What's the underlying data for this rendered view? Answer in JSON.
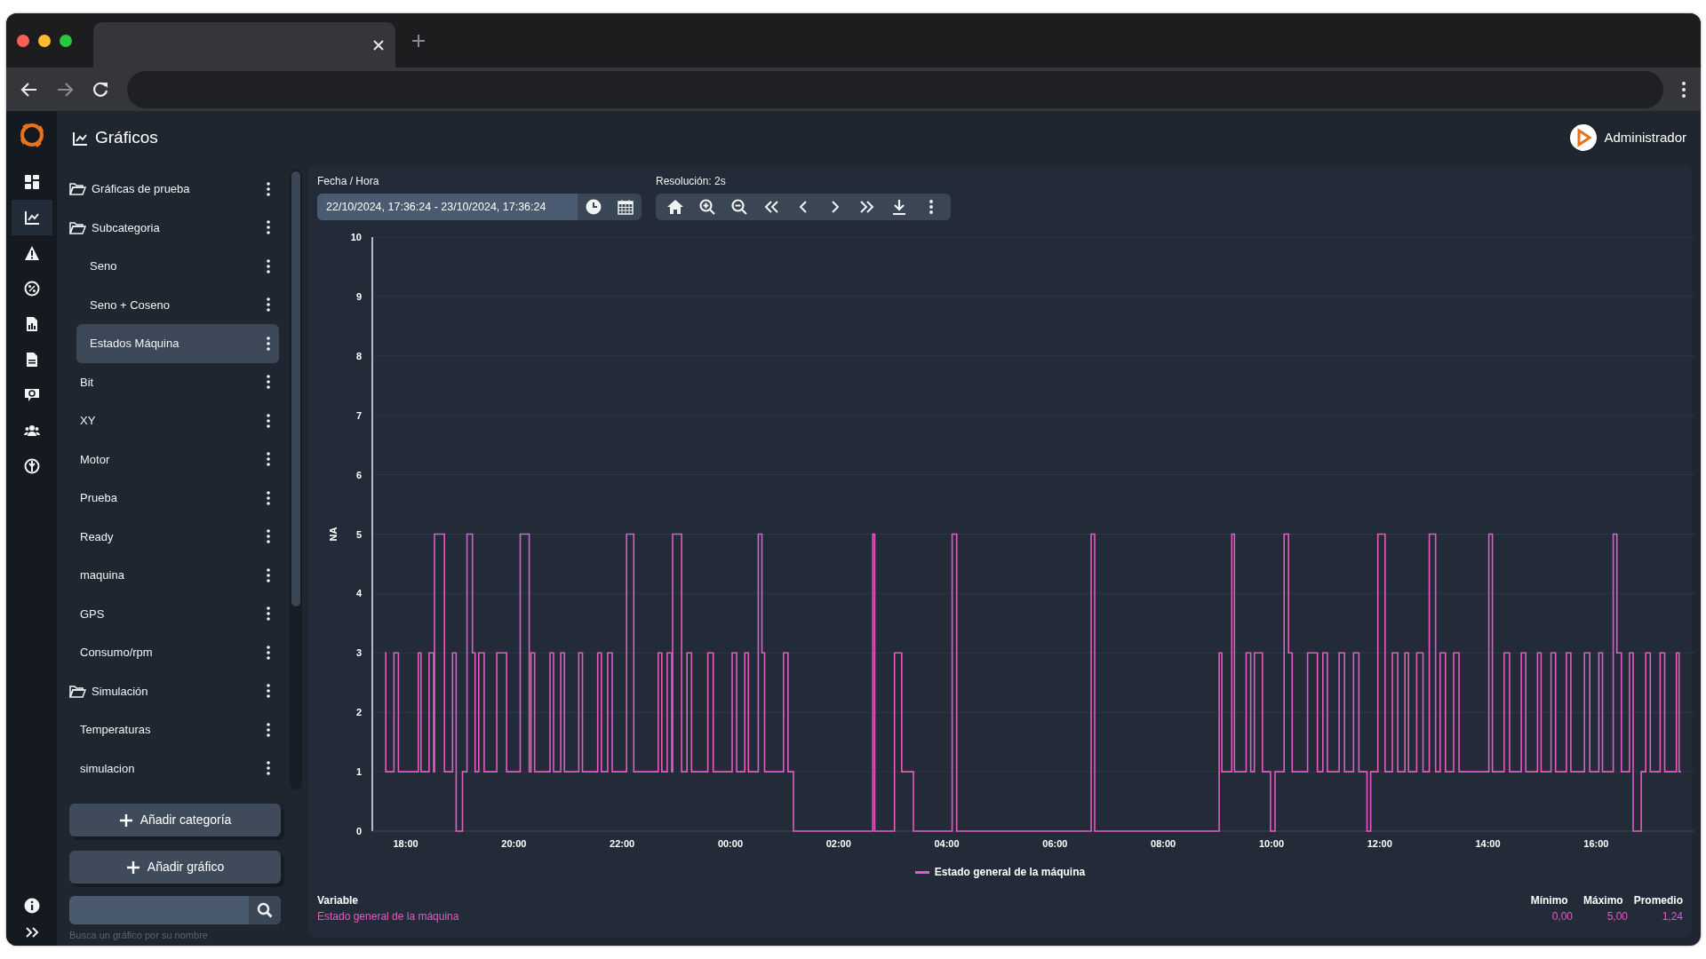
{
  "header": {
    "title": "Gráficos",
    "user": "Administrador"
  },
  "nav_rail": [
    {
      "kind": "dashboard",
      "selected": false
    },
    {
      "kind": "charts",
      "selected": true
    },
    {
      "kind": "alerts",
      "selected": false
    },
    {
      "kind": "percent",
      "selected": false
    },
    {
      "kind": "report",
      "selected": false
    },
    {
      "kind": "document",
      "selected": false
    },
    {
      "kind": "chat",
      "selected": false
    },
    {
      "kind": "users",
      "selected": false
    },
    {
      "kind": "globe",
      "selected": false
    }
  ],
  "tree": {
    "items": [
      {
        "label": "Gráficas de prueba",
        "expanded": true,
        "children": [
          {
            "label": "Subcategoria",
            "expanded": true,
            "children": [
              {
                "label": "Seno",
                "selected": false
              },
              {
                "label": "Seno + Coseno",
                "selected": false
              },
              {
                "label": "Estados Máquina",
                "selected": true
              }
            ]
          },
          {
            "label": "Bit",
            "selected": false
          },
          {
            "label": "XY",
            "selected": false
          },
          {
            "label": "Motor",
            "selected": false
          },
          {
            "label": "Prueba",
            "selected": false
          },
          {
            "label": "Ready",
            "selected": false
          },
          {
            "label": "maquina",
            "selected": false
          },
          {
            "label": "GPS",
            "selected": false
          },
          {
            "label": "Consumo/rpm",
            "selected": false
          }
        ]
      },
      {
        "label": "Simulación",
        "expanded": true,
        "children": [
          {
            "label": "Temperaturas",
            "selected": false
          },
          {
            "label": "simulacion",
            "selected": false
          }
        ]
      }
    ]
  },
  "buttons": [
    "Añadir categoría",
    "Añadir gráfico"
  ],
  "search": {
    "hint": "Busca un gráfico por su nombre"
  },
  "controls": {
    "date_label": "Fecha / Hora",
    "date_value": "22/10/2024, 17:36:24 - 23/10/2024, 17:36:24",
    "resolution": "Resolución: 2s"
  },
  "chart": {
    "chart_data": {
      "type": "line",
      "ylabel": "NA",
      "grid": true,
      "x": [
        "2024-10-22T17:37",
        "2024-10-22T17:38",
        "2024-10-22T17:38",
        "2024-10-22T17:47",
        "2024-10-22T17:47",
        "2024-10-22T17:52",
        "2024-10-22T17:52",
        "2024-10-22T18:14",
        "2024-10-22T18:14",
        "2024-10-22T18:17",
        "2024-10-22T18:17",
        "2024-10-22T18:26",
        "2024-10-22T18:26",
        "2024-10-22T18:31",
        "2024-10-22T18:31",
        "2024-10-22T18:32",
        "2024-10-22T18:32",
        "2024-10-22T18:43",
        "2024-10-22T18:43",
        "2024-10-22T18:52",
        "2024-10-22T18:52",
        "2024-10-22T18:56",
        "2024-10-22T18:56",
        "2024-10-22T19:03",
        "2024-10-22T19:03",
        "2024-10-22T19:08",
        "2024-10-22T19:08",
        "2024-10-22T19:14",
        "2024-10-22T19:14",
        "2024-10-22T19:17",
        "2024-10-22T19:17",
        "2024-10-22T19:21",
        "2024-10-22T19:21",
        "2024-10-22T19:27",
        "2024-10-22T19:27",
        "2024-10-22T19:41",
        "2024-10-22T19:41",
        "2024-10-22T19:52",
        "2024-10-22T19:52",
        "2024-10-22T20:07",
        "2024-10-22T20:07",
        "2024-10-22T20:17",
        "2024-10-22T20:17",
        "2024-10-22T20:19",
        "2024-10-22T20:19",
        "2024-10-22T20:23",
        "2024-10-22T20:23",
        "2024-10-22T20:40",
        "2024-10-22T20:40",
        "2024-10-22T20:44",
        "2024-10-22T20:44",
        "2024-10-22T20:52",
        "2024-10-22T20:52",
        "2024-10-22T20:56",
        "2024-10-22T20:56",
        "2024-10-22T21:12",
        "2024-10-22T21:12",
        "2024-10-22T21:16",
        "2024-10-22T21:16",
        "2024-10-22T21:33",
        "2024-10-22T21:33",
        "2024-10-22T21:37",
        "2024-10-22T21:37",
        "2024-10-22T21:44",
        "2024-10-22T21:44",
        "2024-10-22T21:49",
        "2024-10-22T21:49",
        "2024-10-22T22:05",
        "2024-10-22T22:05",
        "2024-10-22T22:13",
        "2024-10-22T22:13",
        "2024-10-22T22:40",
        "2024-10-22T22:40",
        "2024-10-22T22:44",
        "2024-10-22T22:44",
        "2024-10-22T22:50",
        "2024-10-22T22:50",
        "2024-10-22T22:55",
        "2024-10-22T22:55",
        "2024-10-22T22:56",
        "2024-10-22T22:56",
        "2024-10-22T23:06",
        "2024-10-22T23:06",
        "2024-10-22T23:12",
        "2024-10-22T23:12",
        "2024-10-22T23:17",
        "2024-10-22T23:17",
        "2024-10-22T23:35",
        "2024-10-22T23:35",
        "2024-10-22T23:41",
        "2024-10-22T23:41",
        "2024-10-23T00:02",
        "2024-10-23T00:02",
        "2024-10-23T00:07",
        "2024-10-23T00:07",
        "2024-10-23T00:16",
        "2024-10-23T00:16",
        "2024-10-23T00:20",
        "2024-10-23T00:20",
        "2024-10-23T00:31",
        "2024-10-23T00:31",
        "2024-10-23T00:35",
        "2024-10-23T00:35",
        "2024-10-23T00:38",
        "2024-10-23T00:38",
        "2024-10-23T00:59",
        "2024-10-23T00:59",
        "2024-10-23T01:04",
        "2024-10-23T01:04",
        "2024-10-23T01:10",
        "2024-10-23T01:10",
        "2024-10-23T02:38",
        "2024-10-23T02:38",
        "2024-10-23T02:40",
        "2024-10-23T02:40",
        "2024-10-23T03:02",
        "2024-10-23T03:02",
        "2024-10-23T03:10",
        "2024-10-23T03:10",
        "2024-10-23T03:23",
        "2024-10-23T03:23",
        "2024-10-23T04:06",
        "2024-10-23T04:06",
        "2024-10-23T04:11",
        "2024-10-23T04:11",
        "2024-10-23T06:40",
        "2024-10-23T06:40",
        "2024-10-23T06:44",
        "2024-10-23T06:44",
        "2024-10-23T09:02",
        "2024-10-23T09:02",
        "2024-10-23T09:05",
        "2024-10-23T09:05",
        "2024-10-23T09:16",
        "2024-10-23T09:16",
        "2024-10-23T09:19",
        "2024-10-23T09:19",
        "2024-10-23T09:32",
        "2024-10-23T09:32",
        "2024-10-23T09:37",
        "2024-10-23T09:37",
        "2024-10-23T09:41",
        "2024-10-23T09:41",
        "2024-10-23T09:50",
        "2024-10-23T09:50",
        "2024-10-23T09:59",
        "2024-10-23T09:59",
        "2024-10-23T10:04",
        "2024-10-23T10:04",
        "2024-10-23T10:14",
        "2024-10-23T10:14",
        "2024-10-23T10:19",
        "2024-10-23T10:19",
        "2024-10-23T10:23",
        "2024-10-23T10:23",
        "2024-10-23T10:40",
        "2024-10-23T10:40",
        "2024-10-23T10:51",
        "2024-10-23T10:51",
        "2024-10-23T10:57",
        "2024-10-23T10:57",
        "2024-10-23T11:02",
        "2024-10-23T11:02",
        "2024-10-23T11:15",
        "2024-10-23T11:15",
        "2024-10-23T11:21",
        "2024-10-23T11:21",
        "2024-10-23T11:31",
        "2024-10-23T11:31",
        "2024-10-23T11:37",
        "2024-10-23T11:37",
        "2024-10-23T11:46",
        "2024-10-23T11:46",
        "2024-10-23T11:50",
        "2024-10-23T11:50",
        "2024-10-23T11:58",
        "2024-10-23T11:58",
        "2024-10-23T12:06",
        "2024-10-23T12:06",
        "2024-10-23T12:14",
        "2024-10-23T12:14",
        "2024-10-23T12:20",
        "2024-10-23T12:20",
        "2024-10-23T12:28",
        "2024-10-23T12:28",
        "2024-10-23T12:32",
        "2024-10-23T12:32",
        "2024-10-23T12:41",
        "2024-10-23T12:41",
        "2024-10-23T12:48",
        "2024-10-23T12:48",
        "2024-10-23T12:55",
        "2024-10-23T12:55",
        "2024-10-23T13:02",
        "2024-10-23T13:02",
        "2024-10-23T13:07",
        "2024-10-23T13:07",
        "2024-10-23T13:13",
        "2024-10-23T13:13",
        "2024-10-23T13:22",
        "2024-10-23T13:22",
        "2024-10-23T13:28",
        "2024-10-23T13:28",
        "2024-10-23T14:01",
        "2024-10-23T14:01",
        "2024-10-23T14:05",
        "2024-10-23T14:05",
        "2024-10-23T14:18",
        "2024-10-23T14:18",
        "2024-10-23T14:24",
        "2024-10-23T14:24",
        "2024-10-23T14:37",
        "2024-10-23T14:37",
        "2024-10-23T14:42",
        "2024-10-23T14:42",
        "2024-10-23T14:55",
        "2024-10-23T14:55",
        "2024-10-23T14:59",
        "2024-10-23T14:59",
        "2024-10-23T15:10",
        "2024-10-23T15:10",
        "2024-10-23T15:15",
        "2024-10-23T15:15",
        "2024-10-23T15:27",
        "2024-10-23T15:27",
        "2024-10-23T15:32",
        "2024-10-23T15:32",
        "2024-10-23T15:47",
        "2024-10-23T15:47",
        "2024-10-23T15:53",
        "2024-10-23T15:53",
        "2024-10-23T16:03",
        "2024-10-23T16:03",
        "2024-10-23T16:07",
        "2024-10-23T16:07",
        "2024-10-23T16:19",
        "2024-10-23T16:19",
        "2024-10-23T16:23",
        "2024-10-23T16:23",
        "2024-10-23T16:28",
        "2024-10-23T16:28",
        "2024-10-23T16:37",
        "2024-10-23T16:37",
        "2024-10-23T16:41",
        "2024-10-23T16:41",
        "2024-10-23T16:50",
        "2024-10-23T16:50",
        "2024-10-23T16:55",
        "2024-10-23T16:55",
        "2024-10-23T17:00",
        "2024-10-23T17:00",
        "2024-10-23T17:11",
        "2024-10-23T17:11",
        "2024-10-23T17:16",
        "2024-10-23T17:16",
        "2024-10-23T17:29",
        "2024-10-23T17:29",
        "2024-10-23T17:32",
        "2024-10-23T17:32",
        "2024-10-23T17:34"
      ],
      "series": [
        {
          "name": "Estado general de la máquina",
          "color": "#e45bc4",
          "values": [
            3,
            3,
            1,
            1,
            3,
            3,
            1,
            1,
            3,
            3,
            1,
            1,
            3,
            3,
            1,
            1,
            5,
            5,
            1,
            1,
            3,
            3,
            0,
            0,
            1,
            1,
            5,
            5,
            3,
            3,
            1,
            1,
            3,
            3,
            1,
            1,
            3,
            3,
            1,
            1,
            5,
            5,
            1,
            1,
            3,
            3,
            1,
            1,
            3,
            3,
            1,
            1,
            3,
            3,
            1,
            1,
            3,
            3,
            1,
            1,
            3,
            3,
            1,
            1,
            3,
            3,
            1,
            1,
            5,
            5,
            1,
            1,
            3,
            3,
            1,
            1,
            3,
            3,
            1,
            1,
            5,
            5,
            1,
            1,
            3,
            3,
            1,
            1,
            3,
            3,
            1,
            1,
            3,
            3,
            1,
            1,
            3,
            3,
            1,
            1,
            5,
            5,
            3,
            3,
            1,
            1,
            3,
            3,
            1,
            1,
            0,
            0,
            5,
            5,
            0,
            0,
            3,
            3,
            1,
            1,
            0,
            0,
            5,
            5,
            0,
            0,
            5,
            5,
            0,
            0,
            3,
            3,
            1,
            1,
            5,
            5,
            1,
            1,
            3,
            3,
            1,
            1,
            3,
            3,
            1,
            1,
            0,
            0,
            1,
            1,
            5,
            5,
            3,
            3,
            1,
            1,
            3,
            3,
            1,
            1,
            3,
            3,
            1,
            1,
            3,
            3,
            1,
            1,
            3,
            3,
            1,
            1,
            0,
            0,
            1,
            1,
            5,
            5,
            1,
            1,
            3,
            3,
            1,
            1,
            3,
            3,
            1,
            1,
            3,
            3,
            1,
            1,
            5,
            5,
            1,
            1,
            3,
            3,
            1,
            1,
            3,
            3,
            1,
            1,
            5,
            5,
            1,
            1,
            3,
            3,
            1,
            1,
            3,
            3,
            1,
            1,
            3,
            3,
            1,
            1,
            3,
            3,
            1,
            1,
            3,
            3,
            1,
            1,
            3,
            3,
            1,
            1,
            3,
            3,
            1,
            1,
            5,
            5,
            3,
            3,
            1,
            1,
            3,
            3,
            0,
            0,
            1,
            1,
            3,
            3,
            1,
            1,
            3,
            3,
            1,
            1,
            3,
            3,
            1,
            1
          ]
        }
      ],
      "xlim": [
        "2024-10-22T17:23",
        "2024-10-23T17:50"
      ],
      "ylim": [
        0,
        10
      ],
      "xticks": [
        {
          "value": "2024-10-22T18:00",
          "label": "18:00"
        },
        {
          "value": "2024-10-22T20:00",
          "label": "20:00"
        },
        {
          "value": "2024-10-22T22:00",
          "label": "22:00"
        },
        {
          "value": "2024-10-23T00:00",
          "label": "00:00"
        },
        {
          "value": "2024-10-23T02:00",
          "label": "02:00"
        },
        {
          "value": "2024-10-23T04:00",
          "label": "04:00"
        },
        {
          "value": "2024-10-23T06:00",
          "label": "06:00"
        },
        {
          "value": "2024-10-23T08:00",
          "label": "08:00"
        },
        {
          "value": "2024-10-23T10:00",
          "label": "10:00"
        },
        {
          "value": "2024-10-23T12:00",
          "label": "12:00"
        },
        {
          "value": "2024-10-23T14:00",
          "label": "14:00"
        },
        {
          "value": "2024-10-23T16:00",
          "label": "16:00"
        }
      ],
      "yticks": [
        0,
        1,
        2,
        3,
        4,
        5,
        6,
        7,
        8,
        9,
        10
      ]
    }
  },
  "stats": {
    "columns": [
      "Variable",
      "Mínimo",
      "Máximo",
      "Promedio"
    ],
    "rows": [
      [
        "Estado general de la máquina",
        "0,00",
        "5,00",
        "1,24"
      ]
    ]
  }
}
